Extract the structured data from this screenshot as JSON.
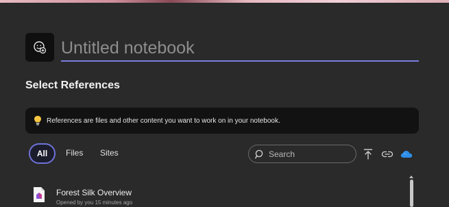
{
  "notebook": {
    "title_placeholder": "Untitled notebook",
    "emoji_button_icon": "emoji-add-icon"
  },
  "references": {
    "heading": "Select References",
    "info_text": "References are files and other content you want to work on in your notebook.",
    "info_icon": "lightbulb-icon"
  },
  "filters": {
    "all": "All",
    "files": "Files",
    "sites": "Sites"
  },
  "search": {
    "placeholder": "Search"
  },
  "toolbar": {
    "upload_icon": "upload-icon",
    "link_icon": "link-icon",
    "cloud_icon": "onedrive-cloud-icon"
  },
  "items": [
    {
      "name": "Forest Silk Overview",
      "meta": "Opened by you 15 minutes ago",
      "icon": "loop-file-icon"
    }
  ],
  "colors": {
    "background": "#2a2a2a",
    "accent": "#7b7fe0",
    "info_box": "#121212",
    "cloud": "#2e8fe8",
    "bulb": "#f5c542"
  }
}
